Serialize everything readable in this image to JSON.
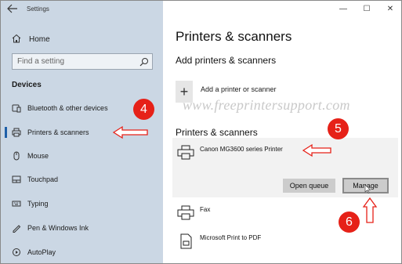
{
  "window": {
    "title": "Settings",
    "minimize": "—",
    "maximize": "☐",
    "close": "✕"
  },
  "sidebar": {
    "home": "Home",
    "search_placeholder": "Find a setting",
    "section": "Devices",
    "items": [
      {
        "label": "Bluetooth & other devices",
        "icon": "bluetooth-icon"
      },
      {
        "label": "Printers & scanners",
        "icon": "printer-icon",
        "selected": true
      },
      {
        "label": "Mouse",
        "icon": "mouse-icon"
      },
      {
        "label": "Touchpad",
        "icon": "touchpad-icon"
      },
      {
        "label": "Typing",
        "icon": "keyboard-icon"
      },
      {
        "label": "Pen & Windows Ink",
        "icon": "pen-icon"
      },
      {
        "label": "AutoPlay",
        "icon": "autoplay-icon"
      }
    ]
  },
  "main": {
    "title": "Printers & scanners",
    "add_heading": "Add printers & scanners",
    "add_label": "Add a printer or scanner",
    "list_heading": "Printers & scanners",
    "printers": [
      {
        "name": "Canon MG3600 series Printer"
      },
      {
        "name": "Fax"
      },
      {
        "name": "Microsoft Print to PDF"
      }
    ],
    "open_queue": "Open queue",
    "manage": "Manage"
  },
  "watermark": "www.freeprintersupport.com",
  "annotations": {
    "step4": "4",
    "step5": "5",
    "step6": "6",
    "color": "#e62118"
  }
}
